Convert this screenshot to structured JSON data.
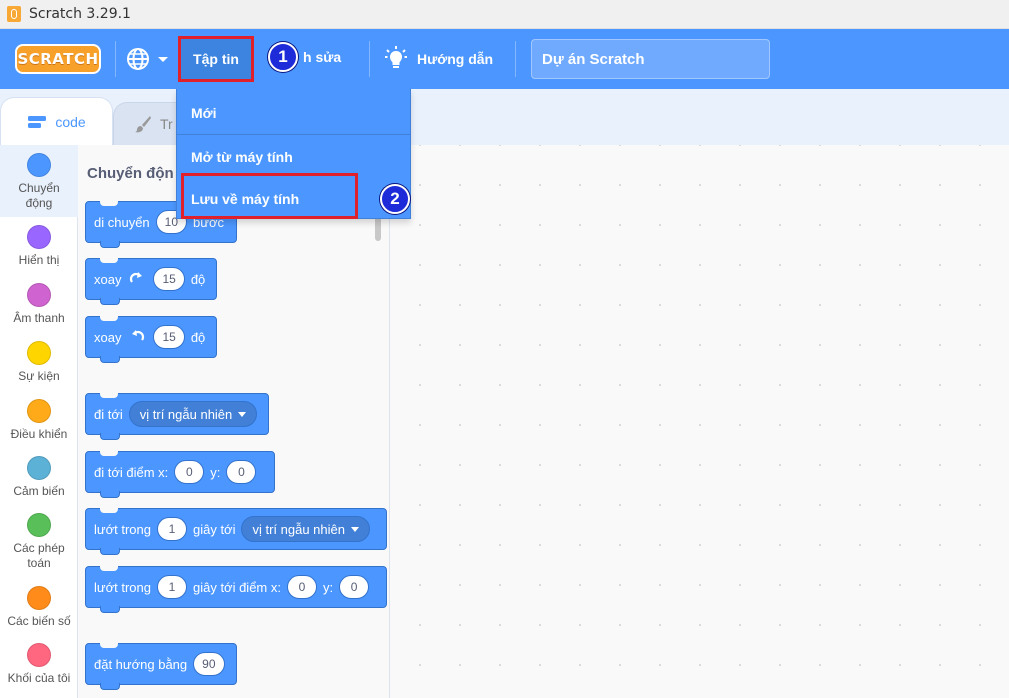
{
  "window": {
    "title": "Scratch 3.29.1"
  },
  "menubar": {
    "logo_text": "SCRATCH",
    "file_label": "Tập tin",
    "edit_label_visible": "h sửa",
    "tutorials_label": "Hướng dẫn",
    "project_title": "Dự án Scratch"
  },
  "annotations": {
    "step1": "1",
    "step2": "2",
    "highlight_color": "#e0202a",
    "badge_color": "#1d2bd9"
  },
  "file_menu": {
    "items": [
      {
        "label": "Mới"
      },
      {
        "label": "Mở từ máy tính"
      },
      {
        "label": "Lưu về máy tính"
      }
    ]
  },
  "tabs": {
    "code_label": "code",
    "costumes_label_visible": "Tr"
  },
  "categories": [
    {
      "label": "Chuyển động",
      "color": "#4c97ff"
    },
    {
      "label": "Hiển thị",
      "color": "#9966ff"
    },
    {
      "label": "Âm thanh",
      "color": "#cf63cf"
    },
    {
      "label": "Sự kiện",
      "color": "#ffd500"
    },
    {
      "label": "Điều khiển",
      "color": "#ffab19"
    },
    {
      "label": "Cảm biến",
      "color": "#5cb1d6"
    },
    {
      "label": "Các phép toán",
      "color": "#59c059"
    },
    {
      "label": "Các biến số",
      "color": "#ff8c1a"
    },
    {
      "label": "Khối của tôi",
      "color": "#ff6680"
    }
  ],
  "palette": {
    "heading_visible": "Chuyển độn",
    "blocks": {
      "move": {
        "text": "di chuyển",
        "value": "10",
        "suffix_visible": "bước"
      },
      "turn_right": {
        "text": "xoay",
        "value": "15",
        "suffix": "độ"
      },
      "turn_left": {
        "text": "xoay",
        "value": "15",
        "suffix": "độ"
      },
      "goto": {
        "text": "đi tới",
        "dropdown": "vị trí ngẫu nhiên"
      },
      "goto_xy": {
        "text": "đi tới điểm x:",
        "x": "0",
        "y_label": "y:",
        "y": "0"
      },
      "glide": {
        "text": "lướt trong",
        "secs": "1",
        "mid": "giây tới",
        "dropdown": "vị trí ngẫu nhiên"
      },
      "glide_xy": {
        "text": "lướt trong",
        "secs": "1",
        "mid": "giây tới điểm x:",
        "x": "0",
        "y_label": "y:",
        "y": "0"
      },
      "point": {
        "text": "đặt hướng bằng",
        "value": "90"
      }
    }
  }
}
